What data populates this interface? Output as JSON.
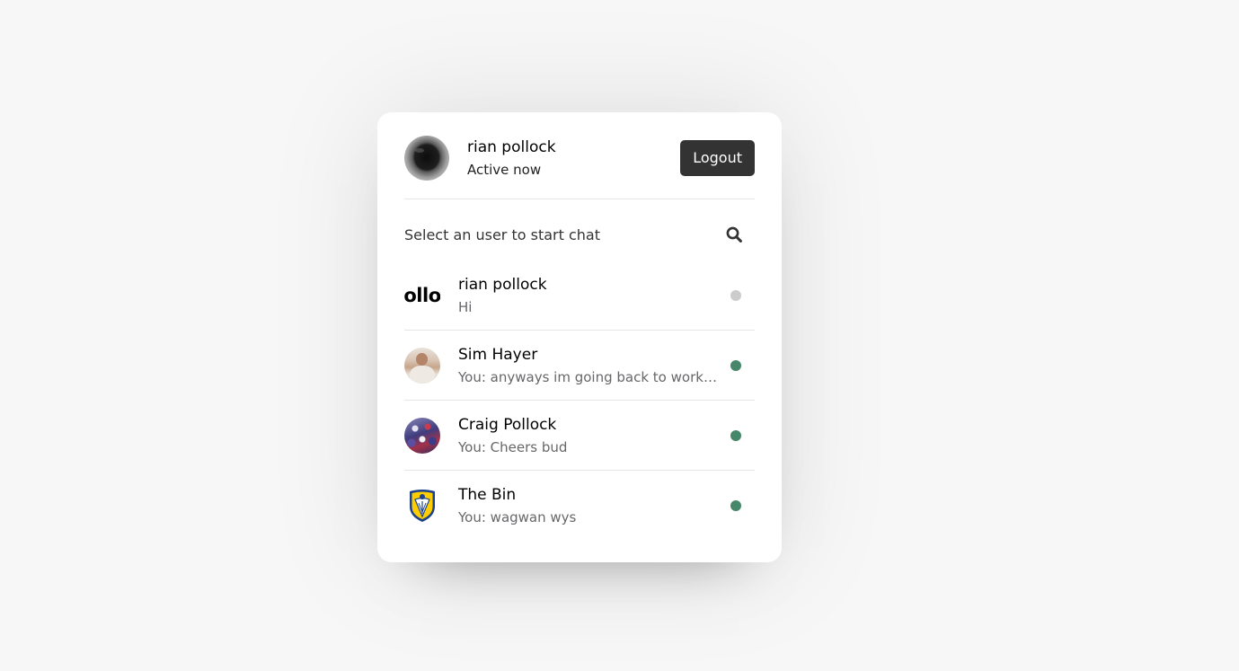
{
  "header": {
    "name": "rian pollock",
    "status": "Active now",
    "logout_label": "Logout"
  },
  "search": {
    "prompt": "Select an user to start chat",
    "icon": "search-icon"
  },
  "users": [
    {
      "name": "rian pollock",
      "last_message": "Hi",
      "avatar_text": "ollo",
      "online": false,
      "status_color": "#cccccc"
    },
    {
      "name": "Sim Hayer",
      "last_message": "You: anyways im going back to work now",
      "online": true,
      "status_color": "#468669"
    },
    {
      "name": "Craig Pollock",
      "last_message": "You: Cheers bud",
      "online": true,
      "status_color": "#468669"
    },
    {
      "name": "The Bin",
      "last_message": "You: wagwan wys",
      "online": true,
      "status_color": "#468669"
    }
  ],
  "colors": {
    "background": "#f7f7f7",
    "card": "#ffffff",
    "button": "#333333",
    "online": "#468669",
    "offline": "#cccccc"
  }
}
